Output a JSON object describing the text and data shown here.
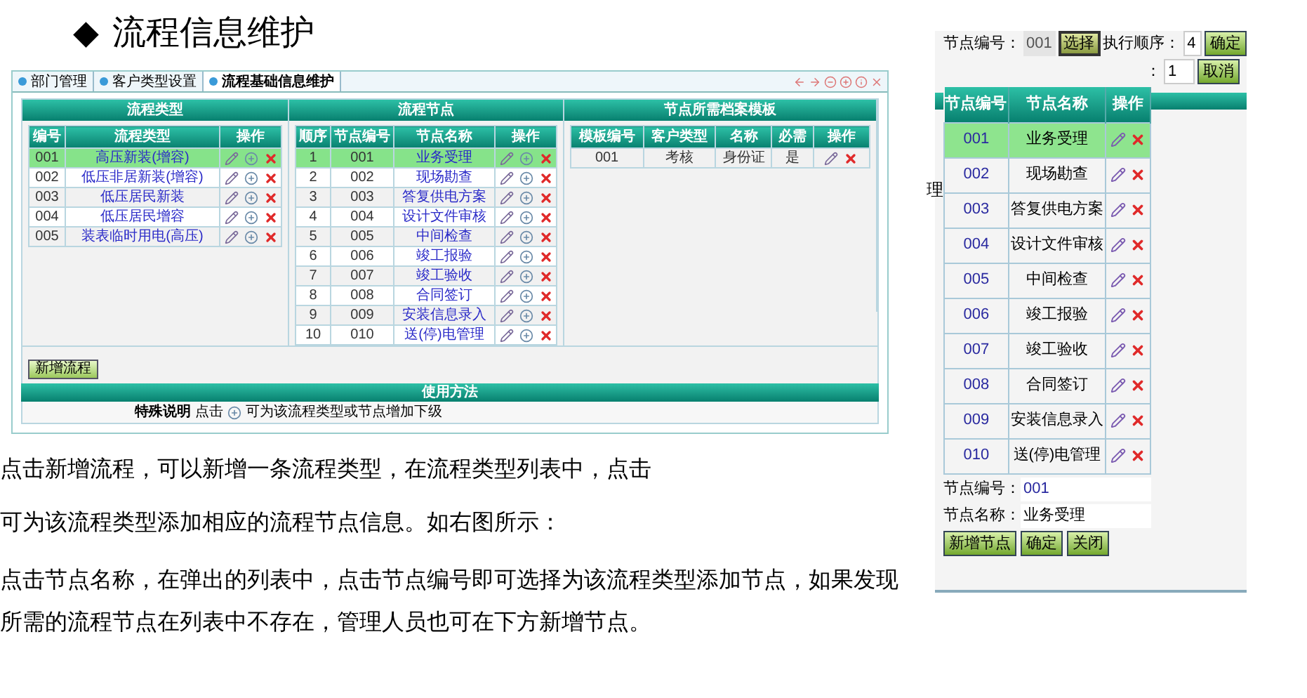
{
  "heading": {
    "bullet": "◆",
    "title": "流程信息维护"
  },
  "admin_screen": {
    "tabs": [
      {
        "label": "部门管理",
        "selected": false
      },
      {
        "label": "客户类型设置",
        "selected": false
      },
      {
        "label": "流程基础信息维护",
        "selected": true
      }
    ],
    "flow_types": {
      "title": "流程类型",
      "columns": [
        "编号",
        "流程类型",
        "操作"
      ],
      "rows": [
        {
          "cells": [
            "001",
            "高压新装(增容)"
          ],
          "selected": true
        },
        {
          "cells": [
            "002",
            "低压非居新装(增容)"
          ],
          "selected": false
        },
        {
          "cells": [
            "003",
            "低压居民新装"
          ],
          "selected": false
        },
        {
          "cells": [
            "004",
            "低压居民增容"
          ],
          "selected": false
        },
        {
          "cells": [
            "005",
            "装表临时用电(高压)"
          ],
          "selected": false
        }
      ]
    },
    "flow_nodes": {
      "title": "流程节点",
      "columns": [
        "顺序",
        "节点编号",
        "节点名称",
        "操作"
      ],
      "rows": [
        {
          "cells": [
            "1",
            "001",
            "业务受理"
          ],
          "selected": true
        },
        {
          "cells": [
            "2",
            "002",
            "现场勘查"
          ],
          "selected": false
        },
        {
          "cells": [
            "3",
            "003",
            "答复供电方案"
          ],
          "selected": false
        },
        {
          "cells": [
            "4",
            "004",
            "设计文件审核"
          ],
          "selected": false
        },
        {
          "cells": [
            "5",
            "005",
            "中间检查"
          ],
          "selected": false
        },
        {
          "cells": [
            "6",
            "006",
            "竣工报验"
          ],
          "selected": false
        },
        {
          "cells": [
            "7",
            "007",
            "竣工验收"
          ],
          "selected": false
        },
        {
          "cells": [
            "8",
            "008",
            "合同签订"
          ],
          "selected": false
        },
        {
          "cells": [
            "9",
            "009",
            "安装信息录入"
          ],
          "selected": false
        },
        {
          "cells": [
            "10",
            "010",
            "送(停)电管理"
          ],
          "selected": false
        }
      ]
    },
    "templates": {
      "title": "节点所需档案模板",
      "columns": [
        "模板编号",
        "客户类型",
        "名称",
        "必需",
        "操作"
      ],
      "rows": [
        {
          "cells": [
            "001",
            "考核",
            "身份证",
            "是"
          ],
          "selected": false
        }
      ]
    },
    "add_button": "新增流程",
    "usage_title": "使用方法",
    "note": {
      "label": "特殊说明",
      "before": "点击",
      "after": "可为该流程类型或节点增加下级"
    }
  },
  "paragraphs": [
    "点击新增流程，可以新增一条流程类型，在流程类型列表中，点击",
    "可为该流程类型添加相应的流程节点信息。如右图所示：",
    "点击节点名称，在弹出的列表中，点击节点编号即可选择为该流程类型添加节点，如果发现所需的流程节点在列表中不存在，管理人员也可在下方新增节点。"
  ],
  "node_screen": {
    "fields": {
      "node_no_label": "节点编号：",
      "node_no": "001",
      "select_button": "选择",
      "order_label": "执行顺序：",
      "order": "4",
      "ok_button": "确定",
      "second_label": "：",
      "second_value": "1",
      "cancel_button": "取消"
    },
    "background_text": "理",
    "popup": {
      "columns": [
        "节点编号",
        "节点名称",
        "操作"
      ],
      "rows": [
        {
          "cells": [
            "001",
            "业务受理"
          ],
          "selected": true
        },
        {
          "cells": [
            "002",
            "现场勘查"
          ],
          "selected": false
        },
        {
          "cells": [
            "003",
            "答复供电方案"
          ],
          "selected": false
        },
        {
          "cells": [
            "004",
            "设计文件审核"
          ],
          "selected": false
        },
        {
          "cells": [
            "005",
            "中间检查"
          ],
          "selected": false
        },
        {
          "cells": [
            "006",
            "竣工报验"
          ],
          "selected": false
        },
        {
          "cells": [
            "007",
            "竣工验收"
          ],
          "selected": false
        },
        {
          "cells": [
            "008",
            "合同签订"
          ],
          "selected": false
        },
        {
          "cells": [
            "009",
            "安装信息录入"
          ],
          "selected": false
        },
        {
          "cells": [
            "010",
            "送(停)电管理"
          ],
          "selected": false
        }
      ],
      "node_no_label": "节点编号：",
      "node_no": "001",
      "node_name_label": "节点名称：",
      "node_name": "业务受理",
      "buttons": [
        "新增节点",
        "确定",
        "关闭"
      ]
    }
  }
}
